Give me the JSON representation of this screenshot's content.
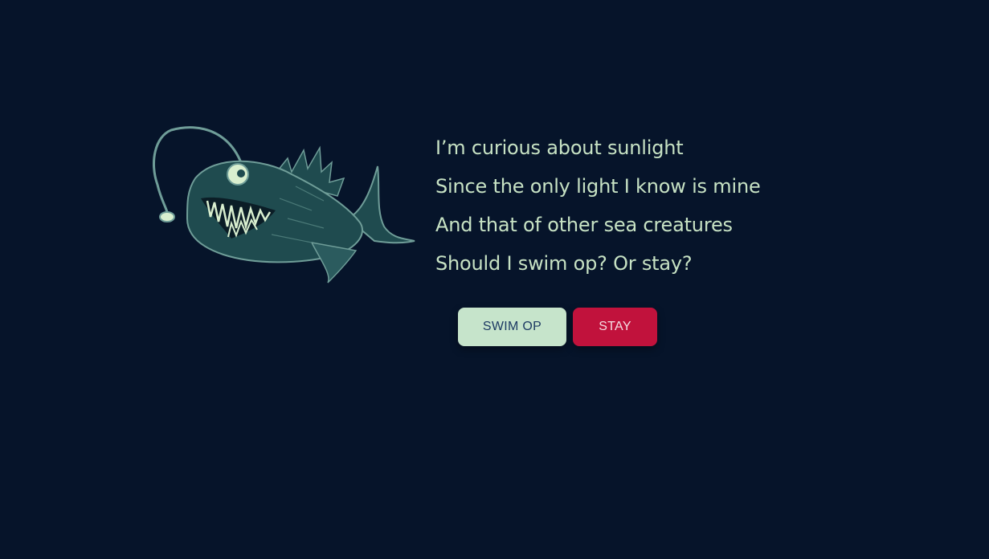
{
  "illustration": {
    "icon": "anglerfish-icon",
    "colors": {
      "body": "#1f4b4f",
      "outline": "#6f9d98",
      "highlight": "#d9efcf"
    }
  },
  "poem": {
    "lines": [
      "I’m curious about sunlight",
      "Since the only light I know is mine",
      "And that of other sea creatures",
      "Should I swim op? Or stay?"
    ]
  },
  "actions": {
    "swim_label": "SWIM OP",
    "stay_label": "STAY"
  },
  "colors": {
    "background": "#06142a",
    "text": "#c7e2c4",
    "swim_button": "#c6e4cb",
    "stay_button": "#c1123c"
  }
}
